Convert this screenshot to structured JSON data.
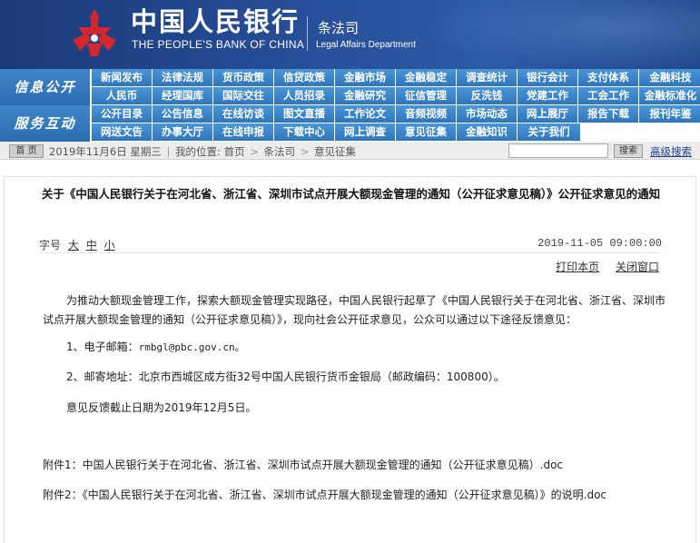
{
  "header": {
    "brand_cn": "中国人民银行",
    "brand_en": "THE PEOPLE'S BANK OF CHINA",
    "dept_cn": "条法司",
    "dept_en": "Legal Affairs Department",
    "logo_icon": "pboc-emblem-icon",
    "colors": {
      "banner": "#23488c",
      "logo": "#d0282e",
      "nav": "#2f75bd"
    }
  },
  "nav": {
    "group1": {
      "label": "信息公开",
      "row1": [
        "新闻发布",
        "法律法规",
        "货币政策",
        "信贷政策",
        "金融市场",
        "金融稳定",
        "调查统计",
        "银行会计",
        "支付体系",
        "金融科技"
      ],
      "row2": [
        "人民币",
        "经理国库",
        "国际交往",
        "人员招录",
        "金融研究",
        "征信管理",
        "反洗钱",
        "党建工作",
        "工会工作",
        "金融标准化"
      ]
    },
    "group2": {
      "label": "服务互动",
      "row1": [
        "公开目录",
        "公告信息",
        "在线访谈",
        "图文直播",
        "工作论文",
        "音频视频",
        "市场动态",
        "网上展厅",
        "报告下载",
        "报刊年鉴"
      ],
      "row2": [
        "网送文告",
        "办事大厅",
        "在线申报",
        "下载中心",
        "网上调查",
        "意见征集",
        "金融知识",
        "关于我们"
      ]
    }
  },
  "crumb": {
    "home": "首 页",
    "date": "2019年11月6日 星期三",
    "position_label": "我的位置:",
    "items": [
      "首页",
      "条法司",
      "意见征集"
    ],
    "search_placeholder": "",
    "search_button": "搜索",
    "advanced_search": "高级搜索"
  },
  "article": {
    "title": "关于《中国人民银行关于在河北省、浙江省、深圳市试点开展大额现金管理的通知（公开征求意见稿）》公开征求意见的通知",
    "font_size_label": "字号",
    "font_sizes": [
      "大",
      "中",
      "小"
    ],
    "published": "2019-11-05 09:00:00",
    "print": "打印本页",
    "close": "关闭窗口",
    "intro": "为推动大额现金管理工作，探索大额现金管理实现路径，中国人民银行起草了《中国人民银行关于在河北省、浙江省、深圳市试点开展大额现金管理的通知（公开征求意见稿）》，现向社会公开征求意见，公众可以通过以下途径反馈意见：",
    "email_label": "1、电子邮箱：",
    "email": "rmbgl@pbc.gov.cn。",
    "mail": "2、邮寄地址：北京市西城区成方街32号中国人民银行货币金银局（邮政编码：100800）。",
    "deadline": "意见反馈截止日期为2019年12月5日。",
    "attachment1": "附件1：中国人民银行关于在河北省、浙江省、深圳市试点开展大额现金管理的通知（公开征求意见稿）.doc",
    "attachment2": "附件2：《中国人民银行关于在河北省、浙江省、深圳市试点开展大额现金管理的通知（公开征求意见稿）》的说明.doc"
  }
}
